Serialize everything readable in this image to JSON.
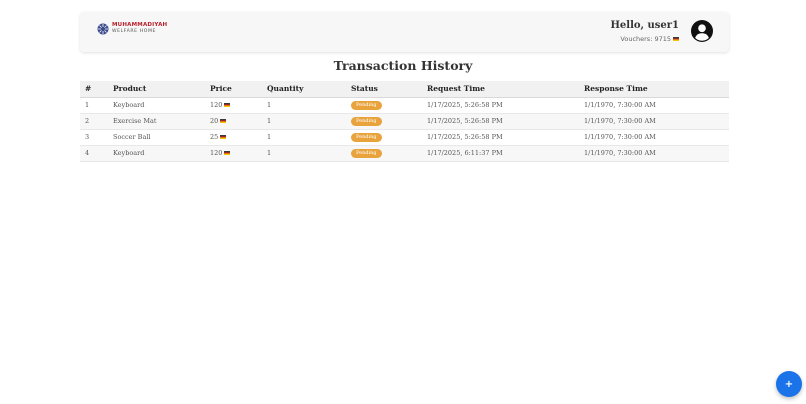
{
  "header": {
    "logo_line1": "MUHAMMADIYAH",
    "logo_line2": "WELFARE HOME",
    "greeting": "Hello, user1",
    "vouchers_label": "Vouchers: 9715"
  },
  "page": {
    "title": "Transaction History"
  },
  "table": {
    "columns": [
      "#",
      "Product",
      "Price",
      "Quantity",
      "Status",
      "Request Time",
      "Response Time"
    ],
    "rows": [
      {
        "num": "1",
        "product": "Keyboard",
        "price": "120",
        "quantity": "1",
        "status": "Pending",
        "request_time": "1/17/2025, 5:26:58 PM",
        "response_time": "1/1/1970, 7:30:00 AM"
      },
      {
        "num": "2",
        "product": "Exercise Mat",
        "price": "20",
        "quantity": "1",
        "status": "Pending",
        "request_time": "1/17/2025, 5:26:58 PM",
        "response_time": "1/1/1970, 7:30:00 AM"
      },
      {
        "num": "3",
        "product": "Soccer Ball",
        "price": "25",
        "quantity": "1",
        "status": "Pending",
        "request_time": "1/17/2025, 5:26:58 PM",
        "response_time": "1/1/1970, 7:30:00 AM"
      },
      {
        "num": "4",
        "product": "Keyboard",
        "price": "120",
        "quantity": "1",
        "status": "Pending",
        "request_time": "1/17/2025, 6:11:37 PM",
        "response_time": "1/1/1970, 7:30:00 AM"
      }
    ]
  },
  "fab": {
    "label": "+"
  },
  "colors": {
    "status_pending": "#e8a33d",
    "fab": "#1a73e8",
    "logo_red": "#b8202a"
  },
  "icons": {
    "avatar": "user-circle-icon",
    "logo": "logo-mark-icon",
    "voucher": "coin-icon"
  }
}
